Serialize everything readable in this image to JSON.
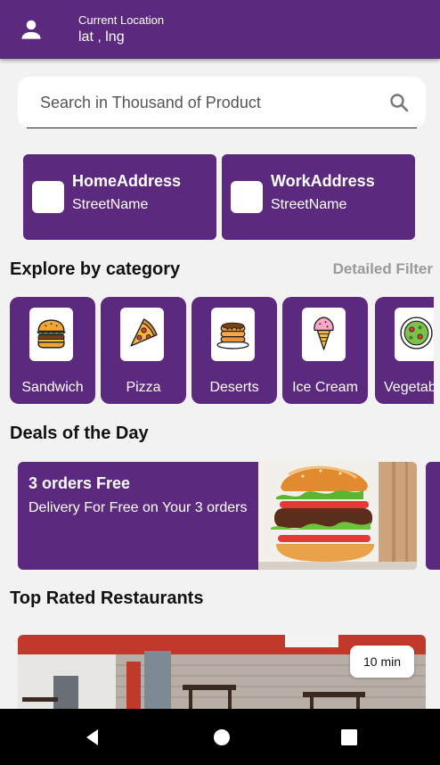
{
  "header": {
    "location_label": "Current Location",
    "location_value": "lat , lng",
    "icon": "person-icon"
  },
  "search": {
    "placeholder": "Search in Thousand of Product",
    "icon": "search-icon"
  },
  "addresses": [
    {
      "name": "HomeAddress",
      "street": "StreetName"
    },
    {
      "name": "WorkAddress",
      "street": "StreetName"
    }
  ],
  "categories_section": {
    "title": "Explore by category",
    "filter_label": "Detailed Filter"
  },
  "categories": [
    {
      "label": "Sandwich",
      "icon": "burger-icon"
    },
    {
      "label": "Pizza",
      "icon": "pizza-icon"
    },
    {
      "label": "Deserts",
      "icon": "pancakes-icon"
    },
    {
      "label": "Ice Cream",
      "icon": "ice-cream-icon"
    },
    {
      "label": "Vegetab",
      "icon": "salad-icon"
    }
  ],
  "deals_section": {
    "title": "Deals of the Day"
  },
  "deals": [
    {
      "title": "3 orders Free",
      "subtitle": "Delivery For Free on Your 3 orders"
    }
  ],
  "restaurants_section": {
    "title": "Top Rated Restaurants"
  },
  "restaurants": [
    {
      "delivery_time": "10 min"
    }
  ],
  "colors": {
    "primary": "#5b2a7e",
    "background": "#f2f2f2",
    "muted_text": "#9a9a9a"
  },
  "system_nav": {
    "icons": [
      "back-icon",
      "home-icon",
      "recents-icon"
    ]
  }
}
